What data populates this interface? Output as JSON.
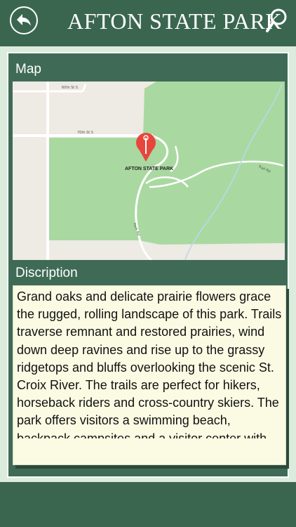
{
  "header": {
    "title": "AFTON STATE PARK",
    "back_icon": "back-arrow-icon",
    "search_icon": "search-icon"
  },
  "map_section": {
    "label": "Map",
    "place_label": "AFTON STATE PARK",
    "street_labels": [
      "60th St S",
      "70th St S",
      "Trail Rd",
      "Park Rd"
    ],
    "pin_icon": "map-pin-icon"
  },
  "description_section": {
    "label": "Discription",
    "text": "Grand oaks and delicate prairie flowers grace the rugged, rolling landscape of this park. Trails traverse remnant and restored prairies, wind down deep ravines and rise up to the grassy ridgetops and bluffs overlooking the scenic St. Croix River. The trails are perfect for hikers, horseback riders and cross-country skiers. The park offers visitors a swimming beach, backpack campsites and a visitor center with interpretive displays."
  },
  "colors": {
    "bar": "#3a6650",
    "panel": "#3f6b56",
    "background": "#dcecdc",
    "desc_box": "#fbfbe4",
    "park_green": "#a9d9a0",
    "pin": "#e8463c"
  }
}
